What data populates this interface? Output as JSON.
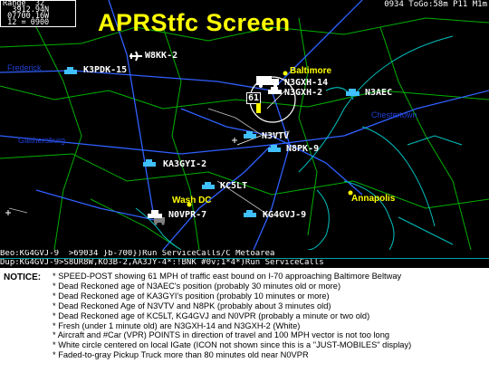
{
  "hud": {
    "range": "Range  32",
    "lat": "  3912.94N",
    "lon": " 07700.16W",
    "time": " 12 = 0900",
    "status_top": "0934 ToGo:58m P11 M1m"
  },
  "title": "APRStfc Screen",
  "cities_yellow": {
    "baltimore": "Baltimore",
    "washdc": "Wash DC",
    "annapolis": "Annapolis"
  },
  "cities_blue": {
    "frederick": "Frederick",
    "gaithersburg": "Gaithersburg",
    "chestertown": "Chestertown"
  },
  "stations": {
    "w8kk": "W8KK-2",
    "k3pdk": "K3PDK-15",
    "n3gxh14": "N3GXH-14",
    "n3gxh2": "N3GXH-2",
    "n3aec": "N3AEC",
    "n3vtv": "N3VTV",
    "n8pk": "N8PK-9",
    "ka3gyi": "KA3GYI-2",
    "kc5lt": "KC5LT",
    "n0vpr": "N0VPR-7",
    "kg4gvj": "KG4GVJ-9"
  },
  "speed_box": "61",
  "status_bar": {
    "line1": "Beo:KG4GVJ-9  >69034 }b-700})Run ServiceCalls/C Metoarea",
    "line2": "Dup:KG4GVJ-9>S8UR8W,KO3B-2,AA3JY-4*:!BNK #0v;1*4*)Run ServiceCalls"
  },
  "notice_label": "NOTICE:",
  "notes": [
    "SPEED-POST showing 61 MPH of traffic east bound on I-70 approaching Baltimore Beltway",
    "Dead Reckoned age of N3AEC's position  (probably 30 minutes old or more)",
    "Dead Reckoned age of KA3GYI's position  (probably 10 minutes or more)",
    "Dead Reckoned Age of N3VTV and N8PK  (probably about 3 minutes old)",
    "Dead Reckoned age of KC5LT, KG4GVJ and N0VPR (probably a minute or two old)",
    "Fresh (under 1 minute old) are N3GXH-14 and N3GXH-2 (White)",
    "Aircraft and #Car (VPR) POINTS in direction of travel and 100 MPH vector is not too long",
    "White circle centered on local IGate (ICON  not shown since this is a \"JUST-MOBILES\" display)",
    "Faded-to-gray Pickup Truck more than 80 minutes old near N0VPR"
  ],
  "colors": {
    "map_bg": "#000000",
    "roads_green": "#00c000",
    "roads_blue": "#3060ff",
    "water_cyan": "#00c0c0",
    "title_yellow": "#ffff00",
    "cars_cyan": "#40c0ff"
  }
}
